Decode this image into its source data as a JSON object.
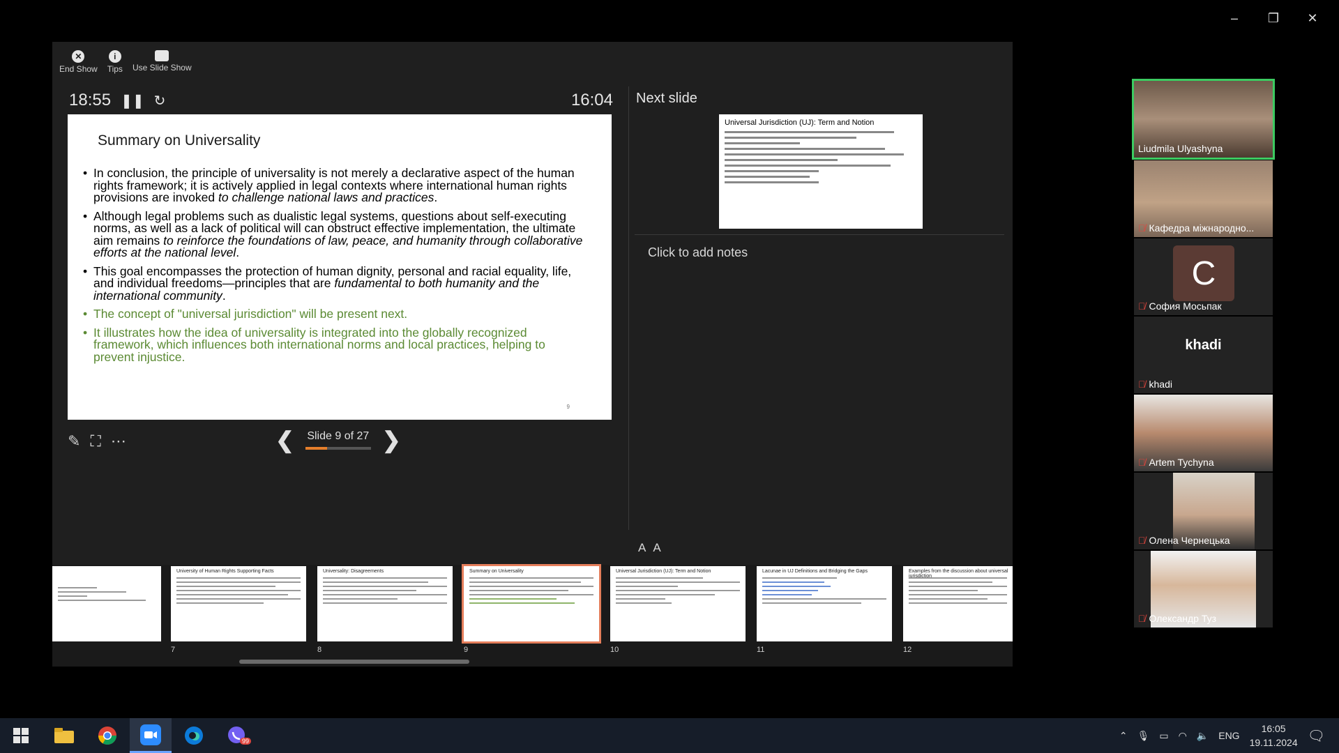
{
  "window_controls": [
    "–",
    "❐",
    "✕"
  ],
  "toolbar": {
    "end_show": "End Show",
    "tips": "Tips",
    "use_slide_show": "Use Slide Show"
  },
  "timer": {
    "elapsed": "18:55",
    "clock": "16:04"
  },
  "current_slide": {
    "title": "Summary on Universality",
    "page": "9",
    "bullets": [
      {
        "plain": "In conclusion, the principle of universality is not merely a declarative aspect of the human rights framework; it is actively applied in legal contexts where international human rights provisions are invoked ",
        "italic": "to challenge national laws and practices",
        "tail": "."
      },
      {
        "plain": "Although legal problems such as dualistic legal systems, questions about self-executing norms, as well as a lack of political will can obstruct effective implementation, the ultimate aim remains ",
        "italic": "to reinforce the foundations of law, peace, and humanity through collaborative efforts at the national level",
        "tail": "."
      },
      {
        "plain": "This goal encompasses the protection of human dignity, personal and racial equality, life, and individual freedoms—principles that are ",
        "italic": "fundamental to both humanity and the international community",
        "tail": "."
      },
      {
        "plain": "The concept of \"universal jurisdiction\" will be present next.",
        "italic": "",
        "tail": ""
      },
      {
        "plain": "It illustrates how the idea of universality is integrated into the globally recognized framework, which influences both international norms and local practices, helping to prevent injustice.",
        "italic": "",
        "tail": ""
      }
    ]
  },
  "navigation": {
    "counter": "Slide 9 of 27",
    "progress_fraction": 0.333
  },
  "next_slide": {
    "label": "Next slide",
    "title": "Universal Jurisdiction (UJ): Term and Notion"
  },
  "notes_placeholder": "Click to add notes",
  "font_controls": [
    "A",
    "A"
  ],
  "filmstrip": [
    {
      "number": "",
      "title": ""
    },
    {
      "number": "7",
      "title": "University of Human Rights Supporting Facts"
    },
    {
      "number": "8",
      "title": "Universality: Disagreements"
    },
    {
      "number": "9",
      "title": "Summary on Universality"
    },
    {
      "number": "10",
      "title": "Universal Jurisdiction (UJ): Term and Notion"
    },
    {
      "number": "11",
      "title": "Lacunae in UJ Definitions and Bridging the Gaps"
    },
    {
      "number": "12",
      "title": "Examples from the discussion about universal jurisdiction"
    }
  ],
  "participants": [
    {
      "name": "Liudmila Ulyashyna",
      "muted": false,
      "active": true,
      "tile": "video"
    },
    {
      "name": "Кафедра міжнародно...",
      "muted": true,
      "active": false,
      "tile": "video"
    },
    {
      "name": "София Мосьпак",
      "muted": true,
      "active": false,
      "tile": "avatar",
      "initial": "C"
    },
    {
      "name": "khadi",
      "muted": true,
      "active": false,
      "tile": "text",
      "display": "khadi"
    },
    {
      "name": "Artem Tychyna",
      "muted": true,
      "active": false,
      "tile": "video"
    },
    {
      "name": "Олена Чернецька",
      "muted": true,
      "active": false,
      "tile": "video"
    },
    {
      "name": "Олександр Туз",
      "muted": true,
      "active": false,
      "tile": "video"
    }
  ],
  "taskbar": {
    "language": "ENG",
    "time": "16:05",
    "date": "19.11.2024",
    "viber_badge": "99"
  }
}
